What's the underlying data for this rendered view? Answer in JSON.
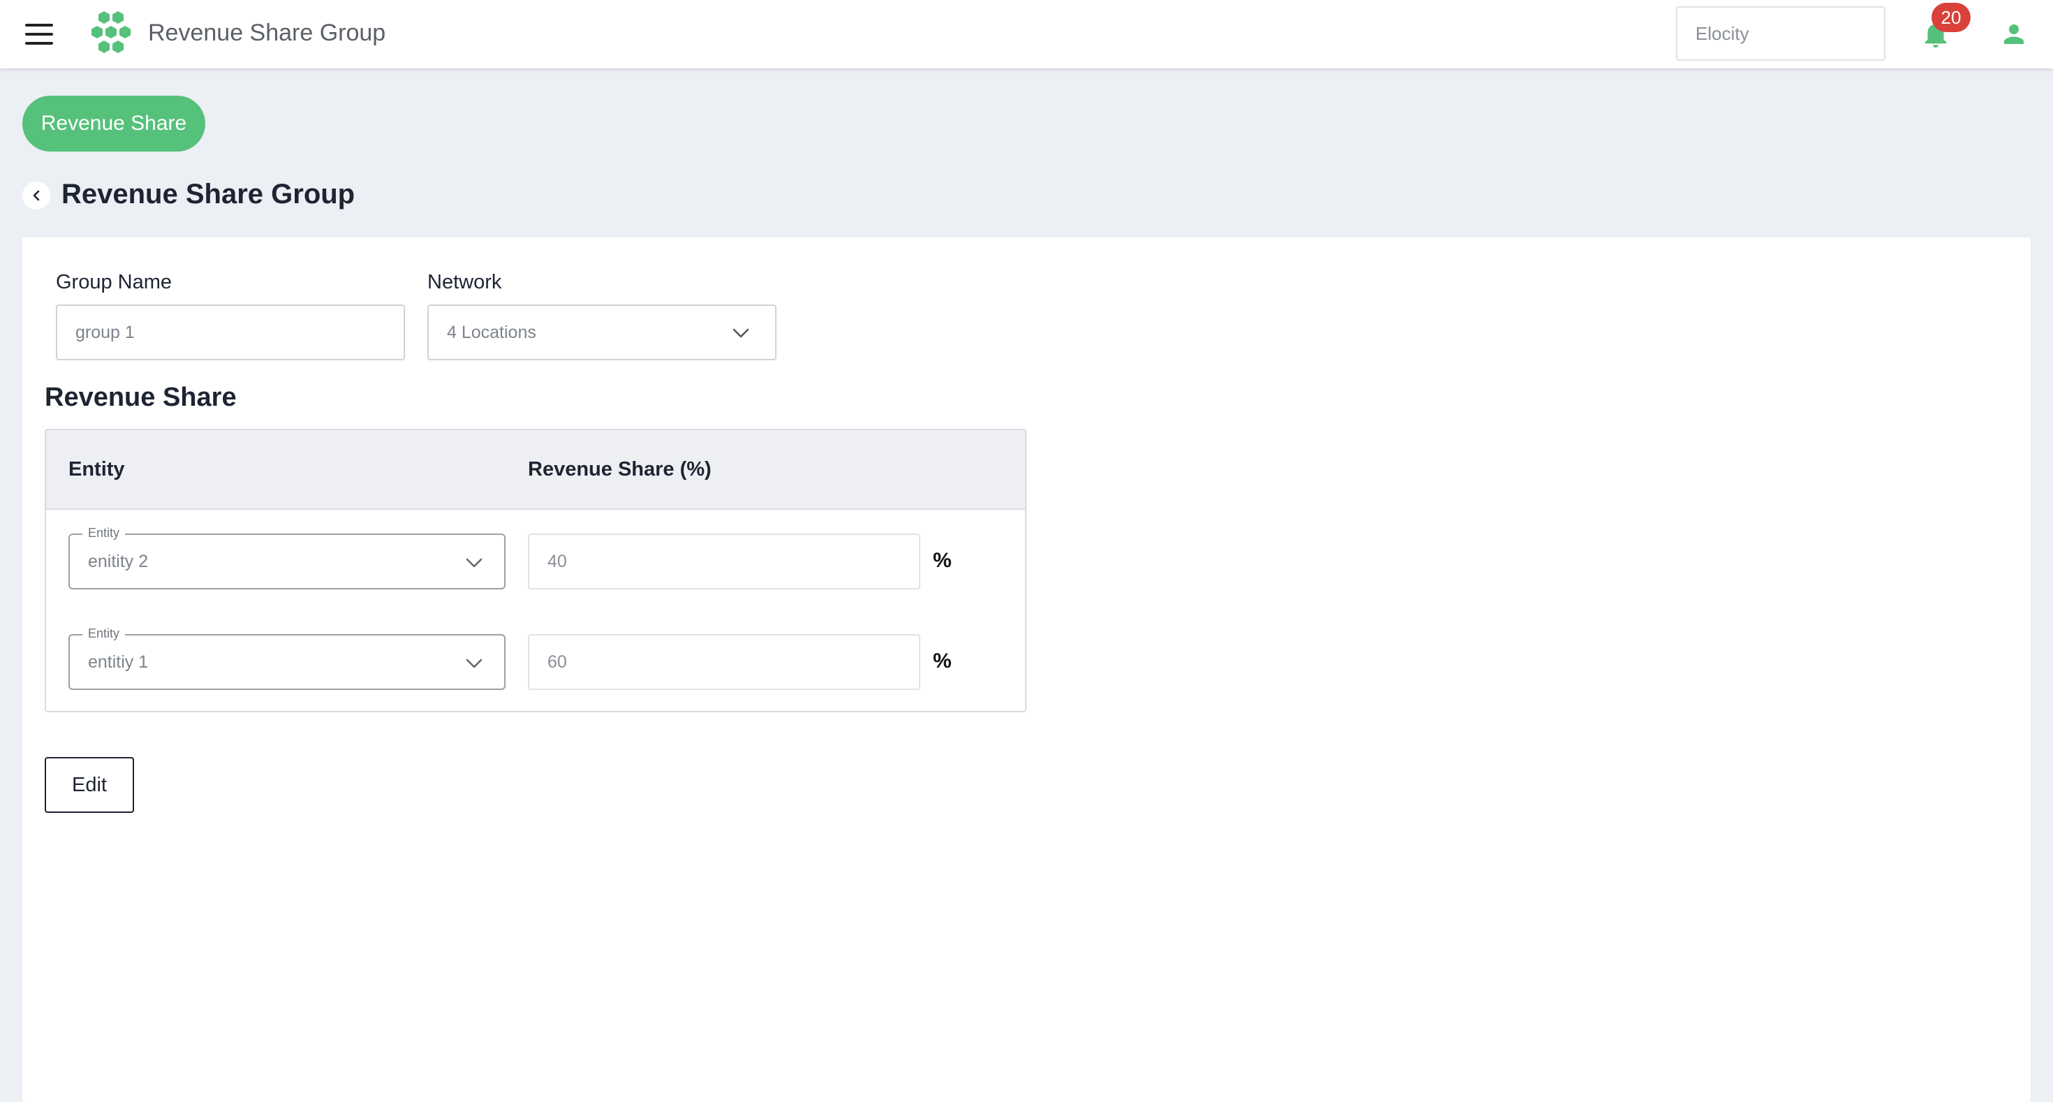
{
  "header": {
    "app_title": "Revenue Share Group",
    "org_field_placeholder": "Elocity",
    "notifications_count": "20",
    "icons": {
      "menu": "hamburger-icon",
      "logo": "hexagon-cluster-logo",
      "bell": "bell-icon",
      "user": "user-icon"
    }
  },
  "nav": {
    "pill_label": "Revenue Share"
  },
  "page": {
    "title": "Revenue Share Group"
  },
  "form": {
    "group_name_label": "Group Name",
    "group_name_value": "group 1",
    "network_label": "Network",
    "network_value": "4 Locations"
  },
  "revenue_share": {
    "section_title": "Revenue Share",
    "columns": {
      "entity": "Entity",
      "share": "Revenue Share (%)"
    },
    "rows": [
      {
        "entity_legend": "Entity",
        "entity_value": "enitity 2",
        "share_value": "40",
        "unit": "%"
      },
      {
        "entity_legend": "Entity",
        "entity_value": "entitiy 1",
        "share_value": "60",
        "unit": "%"
      }
    ]
  },
  "actions": {
    "edit_label": "Edit"
  },
  "colors": {
    "accent_green": "#55c17a",
    "badge_red": "#d9413a",
    "page_bg": "#eceff4"
  }
}
